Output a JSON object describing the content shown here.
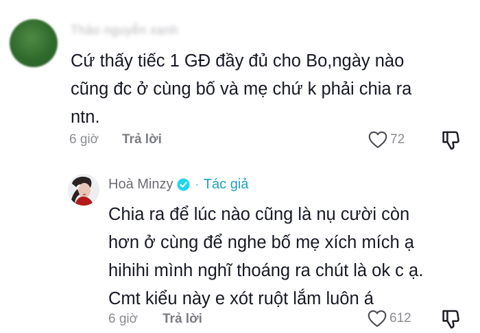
{
  "comment": {
    "username": "Thảo nguyễn xanh",
    "lines": [
      "Cứ thấy tiếc 1 GĐ đầy đủ cho Bo,ngày nào",
      "cũng đc ở cùng bố và mẹ chứ k phải chia ra",
      "ntn."
    ],
    "time": "6 giờ",
    "reply_label": "Trả lời",
    "likes": "72"
  },
  "reply": {
    "author": "Hoà Minzy",
    "badge": "Tác giả",
    "separator": "·",
    "lines": [
      "Chia ra để lúc nào cũng là nụ cười còn",
      "hơn ở cùng để nghe bố mẹ xích mích ạ",
      "hihihi mình nghĩ thoáng ra chút là ok c ạ.",
      "Cmt kiểu này e xót ruột lắm luôn á"
    ],
    "time": "6 giờ",
    "reply_label": "Trả lời",
    "likes": "612"
  },
  "icons": {
    "like": "heart-outline-icon",
    "dislike": "thumbs-down-icon",
    "verified": "verified-check-icon"
  },
  "colors": {
    "text": "#161823",
    "muted": "#8a8b91",
    "author_accent": "#1da1c4",
    "verified": "#20d5ec"
  }
}
